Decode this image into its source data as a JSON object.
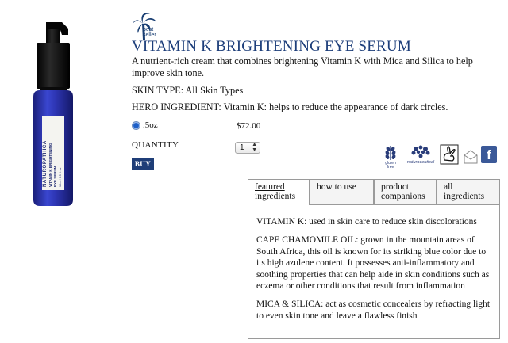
{
  "badge": {
    "icon": "palm-tree-icon",
    "text_line1": "best",
    "text_line2": "seller"
  },
  "product": {
    "title": "VITAMIN K BRIGHTENING EYE SERUM",
    "description": "A nutrient-rich cream that combines brightening Vitamin K with Mica and Silica to help improve skin tone.",
    "skin_type": "SKIN TYPE: All Skin Types",
    "hero_ingredient": "HERO INGREDIENT: Vitamin K: helps to reduce the appearance of dark circles.",
    "size": ".5oz",
    "price": "$72.00",
    "quantity_label": "QUANTITY",
    "quantity_value": "1",
    "buy_label": "BUY",
    "bottle_label": "NATUROPATHICA VITAMIN K BRIGHTENING EYE SERUM"
  },
  "icons": {
    "gluten": "gluten-free-icon",
    "gluten_text_1": "gluten",
    "gluten_text_2": "free",
    "natural": "naturoceutical-icon",
    "natural_text": "naturoceutical",
    "bunny": "cruelty-free-bunny-icon",
    "mail": "email-icon",
    "facebook": "facebook-icon",
    "facebook_glyph": "f"
  },
  "tabs": [
    {
      "line1": "featured",
      "line2": "ingredients"
    },
    {
      "line1": "how to use",
      "line2": ""
    },
    {
      "line1": "product",
      "line2": "companions"
    },
    {
      "line1": "all",
      "line2": "ingredients"
    }
  ],
  "ingredients": [
    "VITAMIN K: used in skin care to reduce skin discolorations",
    "CAPE CHAMOMILE OIL: grown in the mountain areas of South Africa, this oil is known for its striking blue color due to its high azulene content.  It possesses anti-inflammatory and soothing properties that can help aide in skin conditions such as eczema or other conditions that result from inflammation",
    "MICA & SILICA: act as cosmetic concealers by refracting light to even skin tone and leave a flawless finish"
  ],
  "colors": {
    "brand_blue": "#1d3e7a",
    "bottle_blue": "#2b33a8",
    "facebook": "#3b5998"
  }
}
